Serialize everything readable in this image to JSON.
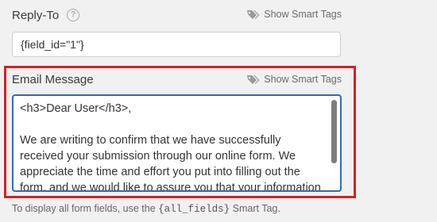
{
  "reply_to": {
    "label": "Reply-To",
    "help_icon": "question-circle-icon",
    "smart_tags_label": "Show Smart Tags",
    "value": "{field_id=\"1\"}"
  },
  "email_message": {
    "label": "Email Message",
    "smart_tags_label": "Show Smart Tags",
    "content": "<h3>Dear User</h3>,\n\nWe are writing to confirm that we have successfully received your submission through our online form. We appreciate the time and effort you put into filling out the form, and we would like to assure you that your information has been"
  },
  "footer": {
    "prefix": "To display all form fields, use the ",
    "code": "{all_fields}",
    "suffix": " Smart Tag."
  },
  "colors": {
    "highlight": "#d42127",
    "focus_border": "#2f6db3"
  }
}
